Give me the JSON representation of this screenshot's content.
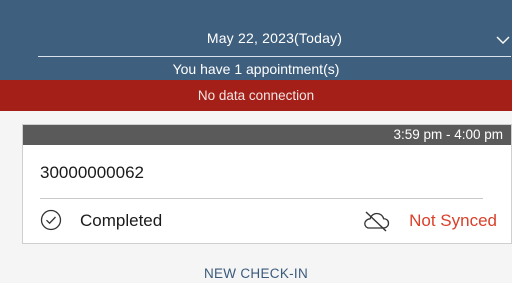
{
  "header": {
    "date_label": "May 22, 2023(Today)",
    "appointment_count": "You have 1 appointment(s)",
    "chevron_icon": "chevron-down-icon"
  },
  "banner": {
    "no_data_text": "No data connection",
    "color": "#a31f18"
  },
  "appointment": {
    "time_range": "3:59 pm - 4:00 pm",
    "id": "30000000062",
    "status_label": "Completed",
    "status_icon": "check-circle-icon",
    "sync_label": "Not Synced",
    "sync_icon": "cloud-off-icon",
    "sync_color": "#d9402a"
  },
  "actions": {
    "new_checkin_label": "NEW CHECK-IN"
  },
  "colors": {
    "header_bg": "#3f5f7e",
    "card_header_bg": "#5a5a5a",
    "link": "#3a5a7c"
  }
}
